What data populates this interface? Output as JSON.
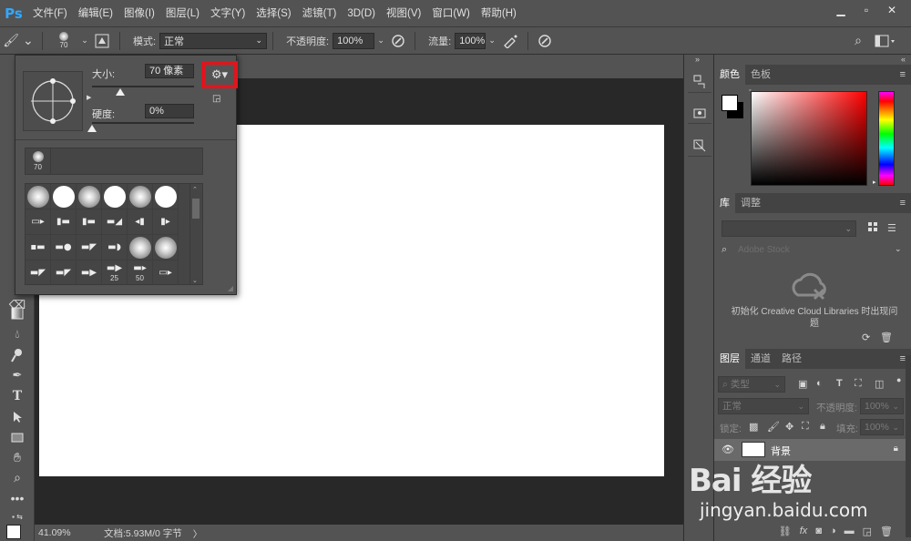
{
  "app": {
    "logo": "Ps"
  },
  "menu": [
    "文件(F)",
    "编辑(E)",
    "图像(I)",
    "图层(L)",
    "文字(Y)",
    "选择(S)",
    "滤镜(T)",
    "3D(D)",
    "视图(V)",
    "窗口(W)",
    "帮助(H)"
  ],
  "window_controls": {
    "minimize": "▁",
    "restore": "▫",
    "close": "✕"
  },
  "options": {
    "brush_size": "70",
    "mode_label": "模式:",
    "mode_value": "正常",
    "opacity_label": "不透明度:",
    "opacity_value": "100%",
    "flow_label": "流量:",
    "flow_value": "100%"
  },
  "brush_popup": {
    "size_label": "大小:",
    "size_value": "70 像素",
    "hardness_label": "硬度:",
    "hardness_value": "0%",
    "size_fraction": 0.28,
    "hardness_fraction": 0.0,
    "recent_size": "70",
    "preset_numbers": [
      "25",
      "50"
    ]
  },
  "status": {
    "zoom": "41.09%",
    "doc": "文档:5.93M/0 字节"
  },
  "color_panel": {
    "tabs": [
      "颜色",
      "色板"
    ],
    "fg": "#ffffff",
    "bg": "#000000"
  },
  "library_panel": {
    "tabs": [
      "库",
      "调整"
    ],
    "search_placeholder": "Adobe Stock",
    "message": "初始化 Creative Cloud Libraries 时出现问题"
  },
  "layers_panel": {
    "tabs": [
      "图层",
      "通道",
      "路径"
    ],
    "filter_label": "类型",
    "blend_mode": "正常",
    "opacity_label": "不透明度:",
    "opacity_value": "100%",
    "lock_label": "锁定:",
    "fill_label": "填充:",
    "fill_value": "100%",
    "layer_name": "背景"
  },
  "watermark": {
    "brand": "Bai 经验",
    "url": "jingyan.baidu.com"
  }
}
